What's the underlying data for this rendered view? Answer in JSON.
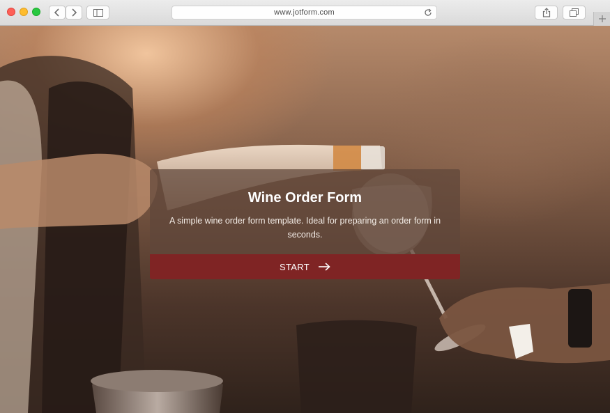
{
  "browser": {
    "url": "www.jotform.com",
    "controls": {
      "back_icon": "chevron-left-icon",
      "forward_icon": "chevron-right-icon",
      "sidebar_icon": "sidebar-icon",
      "reload_icon": "reload-icon",
      "share_icon": "share-icon",
      "tabs_icon": "tabs-icon",
      "new_tab_icon": "plus-icon"
    }
  },
  "form": {
    "title": "Wine Order Form",
    "description": "A simple wine  order form template. Ideal for preparing an order form in seconds.",
    "start_label": "START",
    "start_icon": "arrow-right-icon"
  },
  "colors": {
    "accent": "#7f2424",
    "card_overlay": "rgba(95,70,58,0.72)"
  }
}
